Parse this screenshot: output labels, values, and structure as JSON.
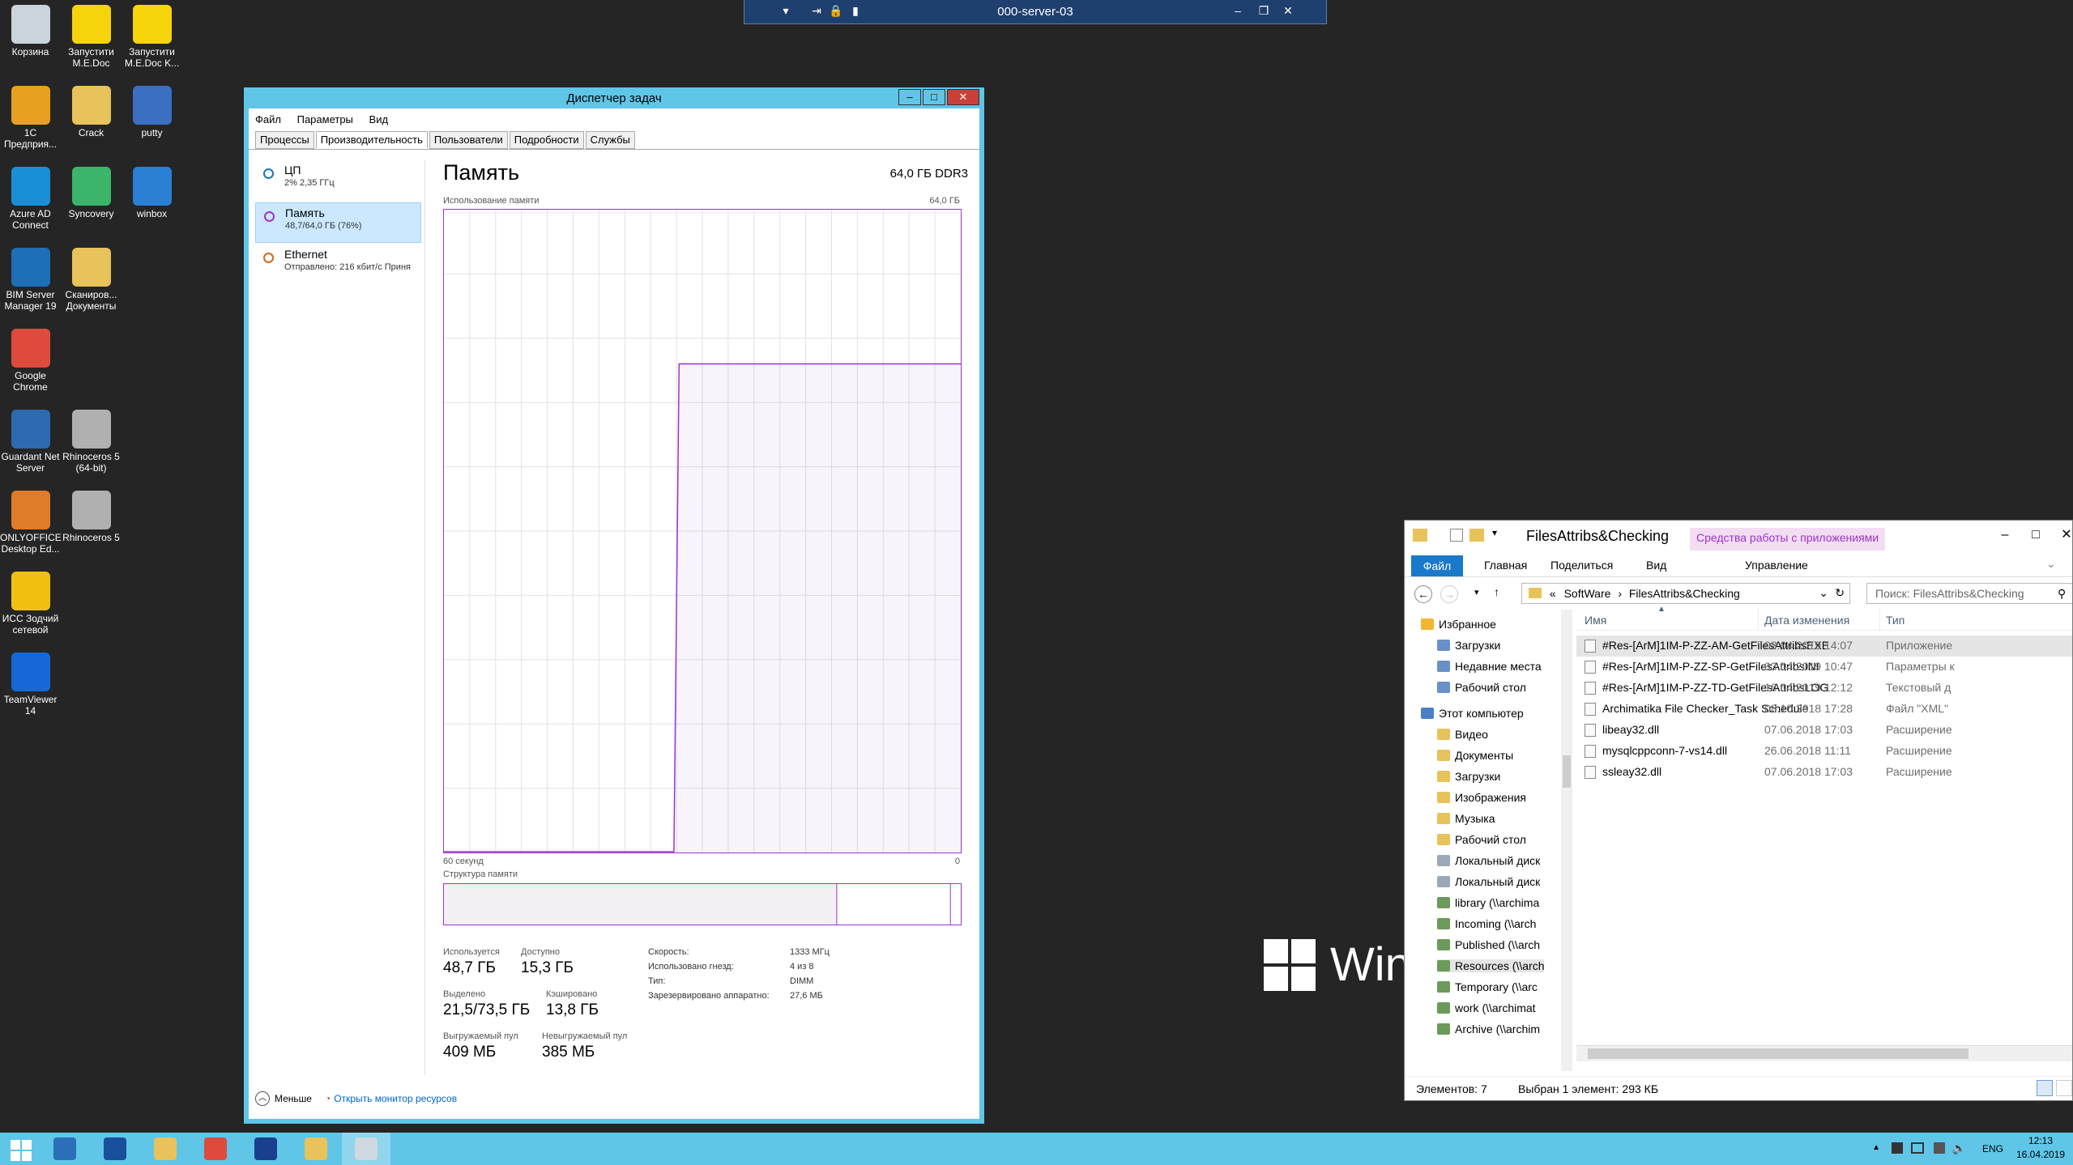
{
  "rdp_bar": {
    "title": "000-server-03"
  },
  "desktop_icons": [
    {
      "label": "Корзина",
      "icon": "recycle-bin-icon",
      "color": "#c9d4dc"
    },
    {
      "label": "Запустити M.E.Doc",
      "icon": "medoc-icon",
      "color": "#f5d40c"
    },
    {
      "label": "Запустити M.E.Doc K...",
      "icon": "medoc-icon",
      "color": "#f5d40c"
    },
    {
      "label": "1С Предприя...",
      "icon": "1c-icon",
      "color": "#e8a020"
    },
    {
      "label": "Crack",
      "icon": "folder-icon",
      "color": "#e8c25a"
    },
    {
      "label": "putty",
      "icon": "putty-icon",
      "color": "#3a6fc2"
    },
    {
      "label": "Azure AD Connect",
      "icon": "azure-icon",
      "color": "#1a8fd8"
    },
    {
      "label": "Syncovery",
      "icon": "syncovery-icon",
      "color": "#3bb56a"
    },
    {
      "label": "winbox",
      "icon": "winbox-icon",
      "color": "#2a7fd4"
    },
    {
      "label": "BIM Server Manager 19",
      "icon": "bim-server-icon",
      "color": "#1d6fb8"
    },
    {
      "label": "Сканиров... Документы",
      "icon": "folder-icon",
      "color": "#e8c25a"
    },
    {
      "label": "Google Chrome",
      "icon": "chrome-icon",
      "color": "#de4b3d"
    },
    {
      "label": "Guardant Net Server",
      "icon": "guardant-icon",
      "color": "#2d6ab0"
    },
    {
      "label": "Rhinoceros 5 (64-bit)",
      "icon": "rhino-icon",
      "color": "#b0b0b0"
    },
    {
      "label": "ONLYOFFICE Desktop Ed...",
      "icon": "onlyoffice-icon",
      "color": "#e07b2a"
    },
    {
      "label": "Rhinoceros 5",
      "icon": "rhino-icon",
      "color": "#b0b0b0"
    },
    {
      "label": "ИСС Зодчий сетевой",
      "icon": "zodchiy-icon",
      "color": "#f0c010"
    },
    {
      "label": "TeamViewer 14",
      "icon": "teamviewer-icon",
      "color": "#1668d8"
    }
  ],
  "task_manager": {
    "title": "Диспетчер задач",
    "menu": [
      "Файл",
      "Параметры",
      "Вид"
    ],
    "tabs": [
      "Процессы",
      "Производительность",
      "Пользователи",
      "Подробности",
      "Службы"
    ],
    "active_tab": "Производительность",
    "resources": [
      {
        "name": "ЦП",
        "sub": "2% 2,35 ГГц",
        "color": "#1779ba"
      },
      {
        "name": "Память",
        "sub": "48,7/64,0 ГБ (76%)",
        "color": "#9b35c9"
      },
      {
        "name": "Ethernet",
        "sub": "Отправлено: 216 кбит/с Приня",
        "color": "#d2691e"
      }
    ],
    "memory": {
      "title": "Память",
      "total": "64,0 ГБ DDR3",
      "usage_label": "Использование памяти",
      "max_label": "64,0 ГБ",
      "time_label": "60 секунд",
      "zero_label": "0",
      "structure_label": "Структура памяти",
      "usage_fraction": 0.76,
      "structure_in_use_fraction": 0.76,
      "structure_modified_fraction": 0.02,
      "stats": {
        "in_use": {
          "label": "Используется",
          "value": "48,7 ГБ"
        },
        "available": {
          "label": "Доступно",
          "value": "15,3 ГБ"
        },
        "committed": {
          "label": "Выделено",
          "value": "21,5/73,5 ГБ"
        },
        "cached": {
          "label": "Кэшировано",
          "value": "13,8 ГБ"
        },
        "paged_pool": {
          "label": "Выгружаемый пул",
          "value": "409 МБ"
        },
        "nonpaged_pool": {
          "label": "Невыгружаемый пул",
          "value": "385 МБ"
        }
      },
      "details": [
        {
          "k": "Скорость:",
          "v": "1333 МГц"
        },
        {
          "k": "Использовано гнезд:",
          "v": "4 из 8"
        },
        {
          "k": "Тип:",
          "v": "DIMM"
        },
        {
          "k": "Зарезервировано аппаратно:",
          "v": "27,6 МБ"
        }
      ]
    },
    "footer": {
      "less": "Меньше",
      "monitor": "Открыть монитор ресурсов"
    }
  },
  "explorer": {
    "title": "FilesAttribs&Checking",
    "tools_tab": "Средства работы с приложениями",
    "ribbon": [
      "Файл",
      "Главная",
      "Поделиться",
      "Вид",
      "Управление"
    ],
    "path": [
      "«",
      "SoftWare",
      "›",
      "FilesAttribs&Checking"
    ],
    "search_placeholder": "Поиск: FilesAttribs&Checking",
    "nav": {
      "favorites": "Избранное",
      "fav_items": [
        "Загрузки",
        "Недавние места",
        "Рабочий стол"
      ],
      "computer": "Этот компьютер",
      "pc_items": [
        "Видео",
        "Документы",
        "Загрузки",
        "Изображения",
        "Музыка",
        "Рабочий стол",
        "Локальный диск",
        "Локальный диск",
        "library (\\\\archima",
        "Incoming (\\\\arch",
        "Published (\\\\arch",
        "Resources (\\\\arch",
        "Temporary (\\\\arc",
        "work (\\\\archimat",
        "Archive (\\\\archim"
      ]
    },
    "columns": {
      "name": "Имя",
      "date": "Дата изменения",
      "type": "Тип"
    },
    "files": [
      {
        "name": "#Res-[ArM]1IM-P-ZZ-AM-GetFilesAttribsEXE",
        "date": "03.04.2019 14:07",
        "type": "Приложение"
      },
      {
        "name": "#Res-[ArM]1IM-P-ZZ-SP-GetFilesAttribsINI",
        "date": "03.04.2019 10:47",
        "type": "Параметры к"
      },
      {
        "name": "#Res-[ArM]1IM-P-ZZ-TD-GetFilesAttribsLOG",
        "date": "16.04.2019 12:12",
        "type": "Текстовый д"
      },
      {
        "name": "Archimatika File Checker_Task Schedule",
        "date": "08.10.2018 17:28",
        "type": "Файл \"XML\""
      },
      {
        "name": "libeay32.dll",
        "date": "07.06.2018 17:03",
        "type": "Расширение"
      },
      {
        "name": "mysqlcppconn-7-vs14.dll",
        "date": "26.06.2018 11:11",
        "type": "Расширение"
      },
      {
        "name": "ssleay32.dll",
        "date": "07.06.2018 17:03",
        "type": "Расширение"
      }
    ],
    "status": {
      "count": "Элементов: 7",
      "selected": "Выбран 1 элемент: 293 КБ"
    }
  },
  "watermark": "Win",
  "taskbar": {
    "apps": [
      "start-icon",
      "server-manager-icon",
      "powershell-icon",
      "file-explorer-icon",
      "chrome-icon",
      "save-disk-icon",
      "notepad-icon",
      "task-manager-icon"
    ],
    "lang": "ENG",
    "time": "12:13",
    "date": "16.04.2019"
  }
}
